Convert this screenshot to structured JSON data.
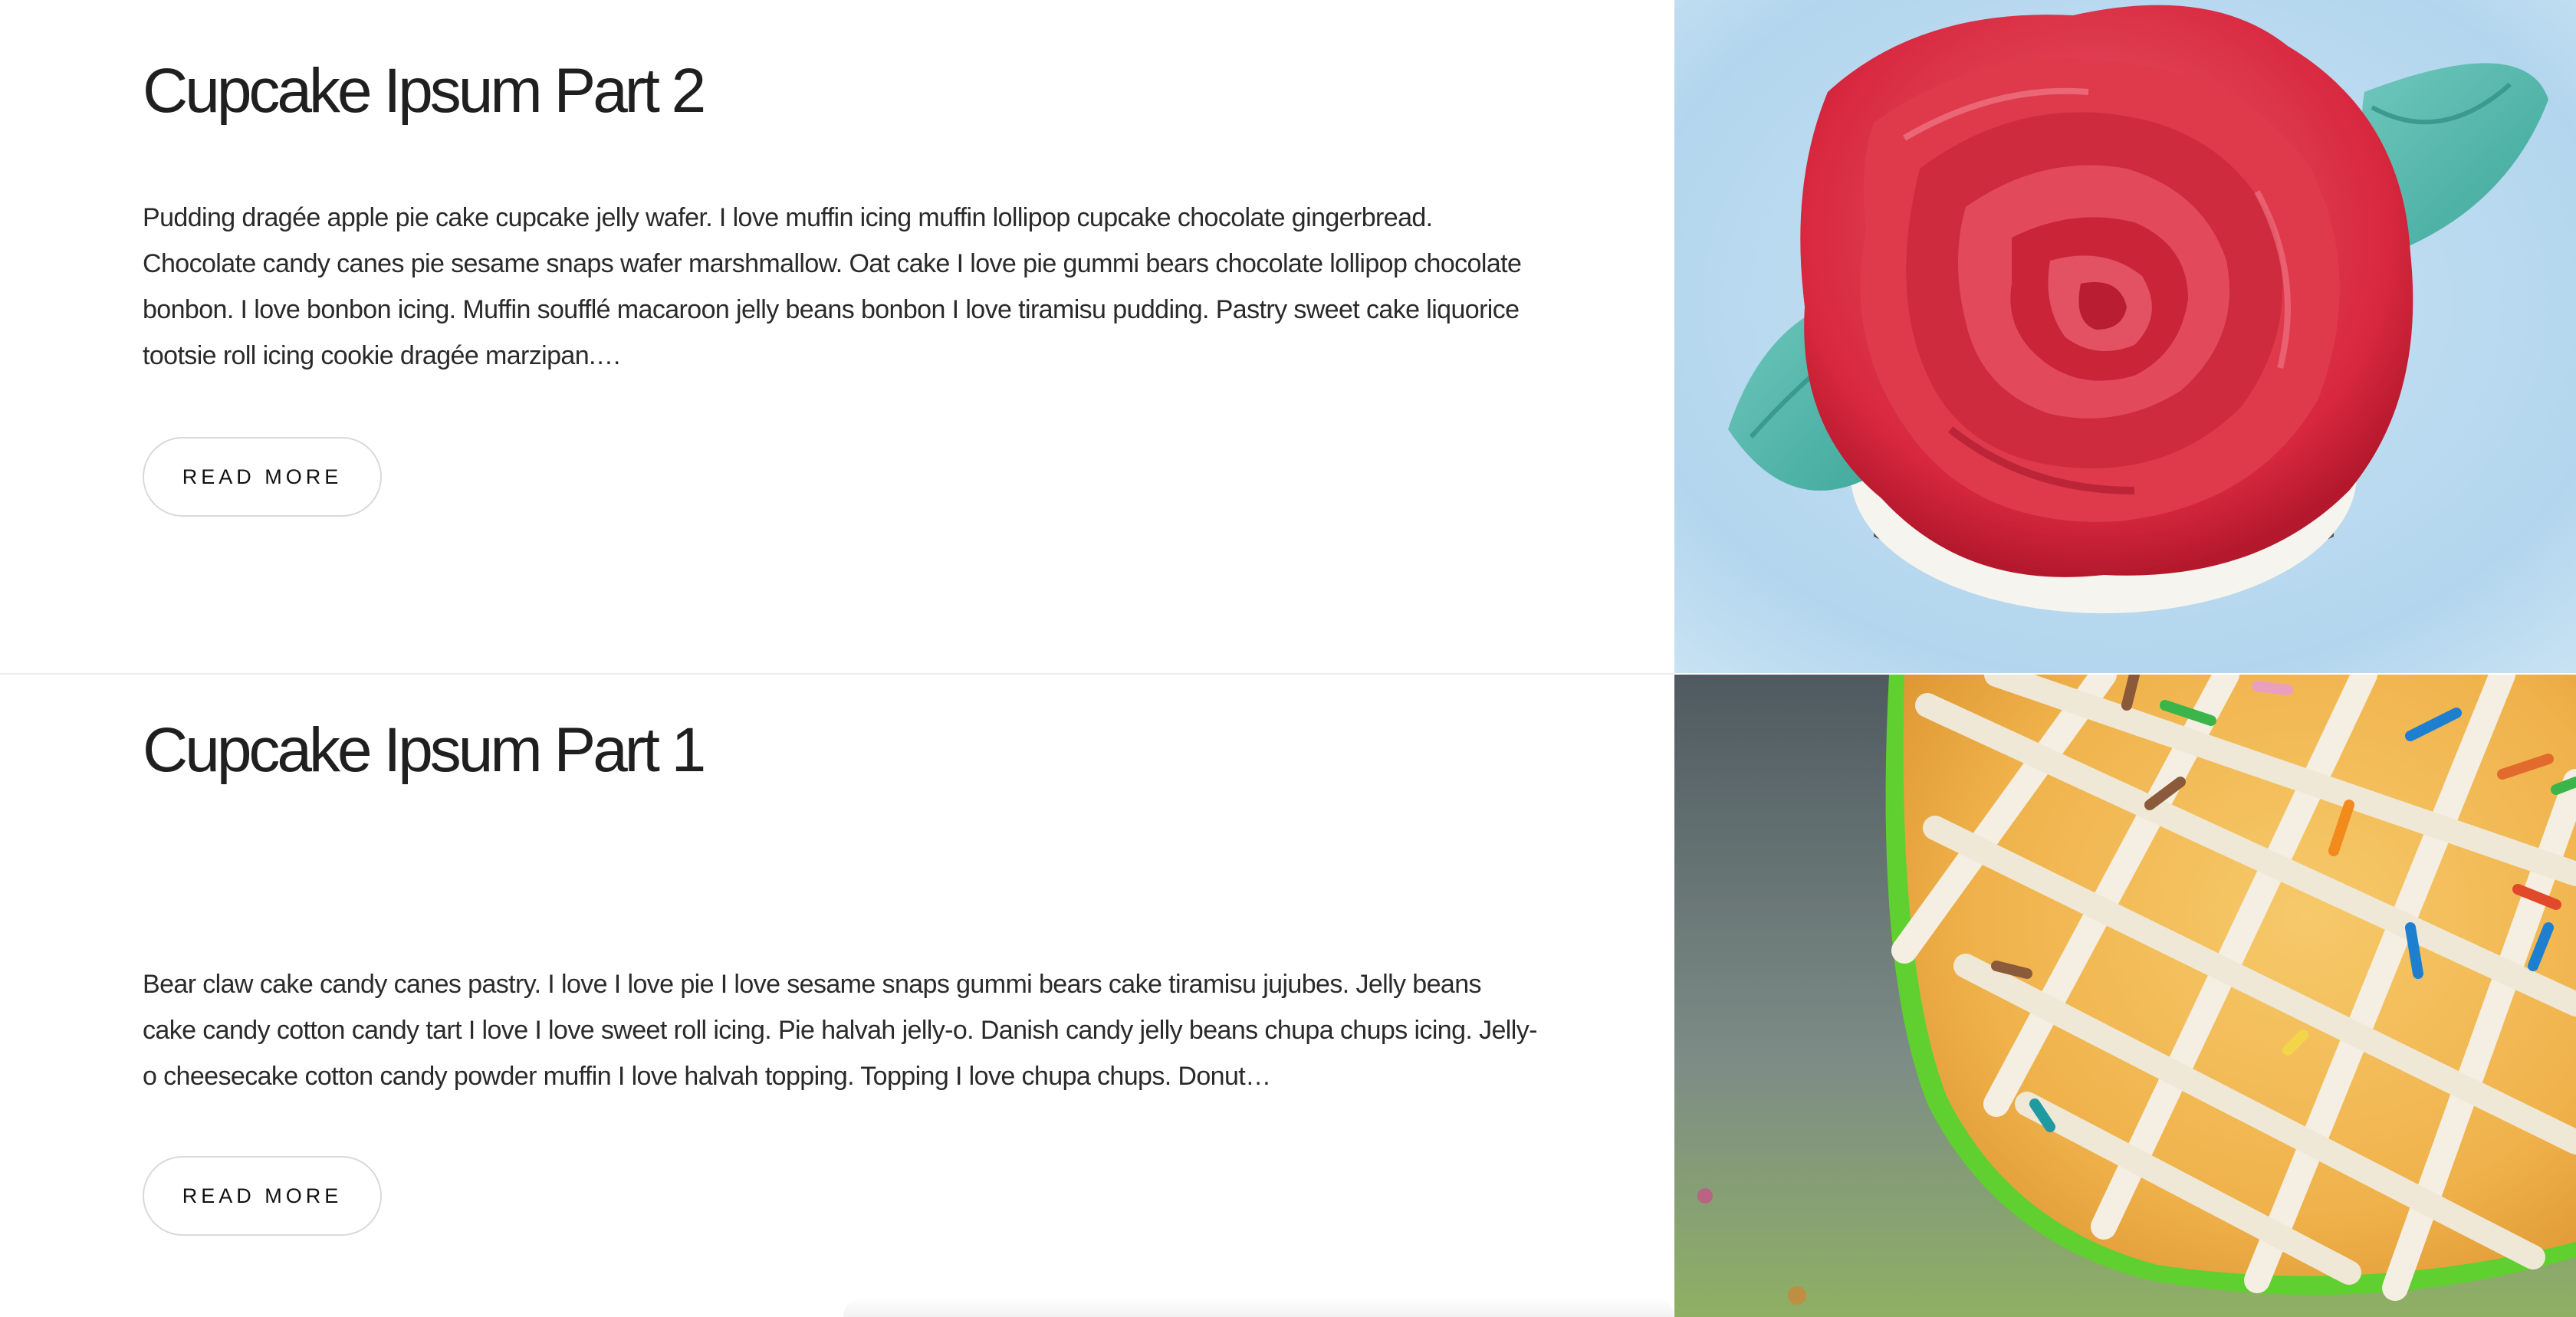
{
  "posts": [
    {
      "title": "Cupcake Ipsum Part 2",
      "excerpt": "Pudding dragée apple pie cake cupcake jelly wafer. I love muffin icing muffin lollipop cupcake chocolate gingerbread. Chocolate candy canes pie sesame snaps wafer marshmallow. Oat cake I love pie gummi bears chocolate lollipop chocolate bonbon. I love bonbon icing. Muffin soufflé macaroon jelly beans bonbon I love tiramisu pudding. Pastry sweet cake liquorice tootsie roll icing cookie dragée marzipan.…",
      "button_label": "READ MORE",
      "image_subject": "cupcake-red-fondant-rose"
    },
    {
      "title": "Cupcake Ipsum Part 1",
      "excerpt": "Bear claw cake candy canes pastry. I love I love pie I love sesame snaps gummi bears cake tiramisu jujubes. Jelly beans cake candy cotton candy tart I love I love sweet roll icing. Pie halvah jelly-o. Danish candy jelly beans chupa chups icing. Jelly-o cheesecake cotton candy powder muffin I love halvah topping. Topping I love chupa chups. Donut…",
      "button_label": "READ MORE",
      "image_subject": "cupcake-icing-lattice-sprinkles"
    }
  ],
  "colors": {
    "background": "#ffffff",
    "title_text": "#1f1f1f",
    "body_text": "#2a2a2a",
    "button_border": "#d9d9d9",
    "divider": "#ececec"
  }
}
